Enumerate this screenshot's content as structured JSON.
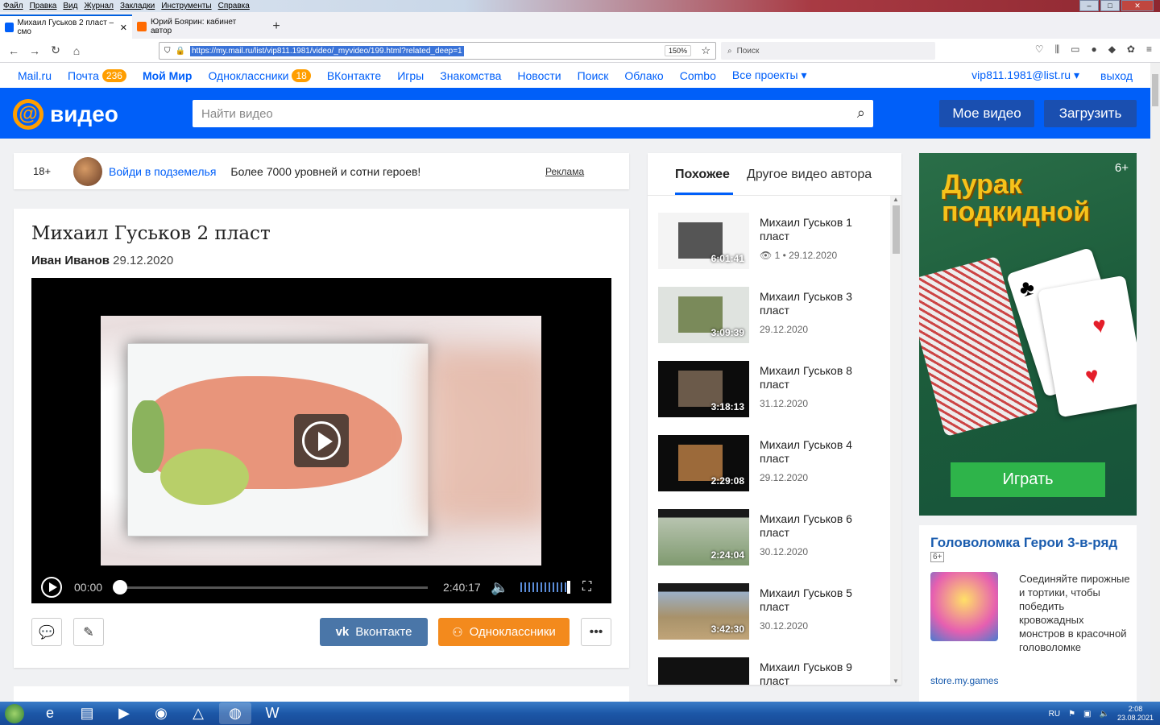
{
  "menubar": [
    "Файл",
    "Правка",
    "Вид",
    "Журнал",
    "Закладки",
    "Инструменты",
    "Справка"
  ],
  "tabs": [
    {
      "title": "Михаил Гуськов 2 пласт – смо",
      "active": true,
      "color": "#005ff9"
    },
    {
      "title": "Юрий Боярин: кабинет автор",
      "active": false,
      "color": "#ff6a00"
    }
  ],
  "address": {
    "url": "https://my.mail.ru/list/vip811.1981/video/_myvideo/199.html?related_deep=1",
    "zoom": "150%",
    "search_placeholder": "Поиск"
  },
  "portal": {
    "links": [
      {
        "label": "Mail.ru",
        "bold": false
      },
      {
        "label": "Почта",
        "badge": "236",
        "bold": false
      },
      {
        "label": "Мой Мир",
        "bold": true
      },
      {
        "label": "Одноклассники",
        "badge": "18",
        "bold": false
      },
      {
        "label": "ВКонтакте",
        "bold": false
      },
      {
        "label": "Игры",
        "bold": false
      },
      {
        "label": "Знакомства",
        "bold": false
      },
      {
        "label": "Новости",
        "bold": false
      },
      {
        "label": "Поиск",
        "bold": false
      },
      {
        "label": "Облако",
        "bold": false
      },
      {
        "label": "Combo",
        "bold": false
      },
      {
        "label": "Все проекты ▾",
        "bold": false
      }
    ],
    "user": "vip811.1981@list.ru ▾",
    "exit": "выход"
  },
  "header": {
    "logo": "видео",
    "search_placeholder": "Найти видео",
    "my_video": "Мое видео",
    "upload": "Загрузить"
  },
  "adbar": {
    "age": "18+",
    "link": "Войди в подземелья",
    "desc": "Более 7000 уровней и сотни героев!",
    "tag": "Реклама"
  },
  "video": {
    "title": "Михаил Гуськов 2 пласт",
    "author": "Иван Иванов",
    "date": "29.12.2020",
    "time_current": "00:00",
    "time_total": "2:40:17",
    "share_vk": "Вконтакте",
    "share_ok": "Одноклассники",
    "more": "•••"
  },
  "related": {
    "tab_similar": "Похожее",
    "tab_author": "Другое видео автора",
    "items": [
      {
        "title": "Михаил Гуськов 1 пласт",
        "duration": "6:01:41",
        "views": "1",
        "date": "29.12.2020",
        "thumb": "#e8e8e8"
      },
      {
        "title": "Михаил Гуськов 3 пласт",
        "duration": "3:09:39",
        "date": "29.12.2020",
        "thumb": "#7a8a5a"
      },
      {
        "title": "Михаил Гуськов 8 пласт",
        "duration": "3:18:13",
        "date": "31.12.2020",
        "thumb": "#6b5a4a"
      },
      {
        "title": "Михаил Гуськов 4 пласт",
        "duration": "2:29:08",
        "date": "29.12.2020",
        "thumb": "#9c6a3a"
      },
      {
        "title": "Михаил Гуськов 6 пласт",
        "duration": "2:24:04",
        "date": "30.12.2020",
        "thumb": "#8aa88a"
      },
      {
        "title": "Михаил Гуськов 5 пласт",
        "duration": "3:42:30",
        "date": "30.12.2020",
        "thumb": "#a89a7a"
      },
      {
        "title": "Михаил Гуськов 9 пласт",
        "duration": "",
        "date": "",
        "thumb": "#444"
      }
    ]
  },
  "ad_big": {
    "age": "6+",
    "title": "Дурак подкидной",
    "button": "Играть"
  },
  "ad_small": {
    "title": "Головоломка Герои 3-в-ряд",
    "age": "6+",
    "text": "Соединяйте пирожные и тортики, чтобы победить кровожадных монстров в красочной головоломке",
    "source": "store.my.games"
  },
  "taskbar": {
    "lang": "RU",
    "time": "2:08",
    "date": "23.08.2021"
  }
}
